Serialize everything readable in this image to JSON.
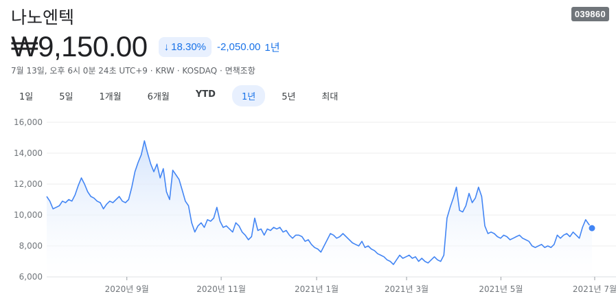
{
  "stock": {
    "name": "나노엔텍",
    "ticker": "039860",
    "price": "₩9,150.00",
    "change_percent": "18.30%",
    "change_arrow": "down-arrow-icon",
    "change_abs": "-2,050.00",
    "change_period": "1년",
    "meta": "7월 13일, 오후 6시 0분 24초 UTC+9 · KRW · KOSDAQ · 면책조항"
  },
  "tabs": [
    {
      "label": "1일",
      "active": false
    },
    {
      "label": "5일",
      "active": false
    },
    {
      "label": "1개월",
      "active": false
    },
    {
      "label": "6개월",
      "active": false
    },
    {
      "label": "YTD",
      "active": false
    },
    {
      "label": "1년",
      "active": true
    },
    {
      "label": "5년",
      "active": false
    },
    {
      "label": "최대",
      "active": false
    }
  ],
  "colors": {
    "line": "#4285f4",
    "fill_top": "#d2e3fc",
    "accent": "#1a73e8"
  },
  "chart_data": {
    "type": "area",
    "ylim": [
      6000,
      16000
    ],
    "yticks": [
      "16,000",
      "14,000",
      "12,000",
      "10,000",
      "8,000",
      "6,000"
    ],
    "ytick_values": [
      16000,
      14000,
      12000,
      10000,
      8000,
      6000
    ],
    "xticks": [
      {
        "label": "2020년 9월",
        "x": 0.147
      },
      {
        "label": "2020년 11월",
        "x": 0.32
      },
      {
        "label": "2021년 1월",
        "x": 0.495
      },
      {
        "label": "2021년 3월",
        "x": 0.66
      },
      {
        "label": "2021년 5월",
        "x": 0.833
      },
      {
        "label": "2021년 7월",
        "x": 1.005
      }
    ],
    "series": [
      {
        "values": [
          11200,
          10900,
          10400,
          10500,
          10600,
          10900,
          10800,
          11000,
          10900,
          11300,
          11900,
          12400,
          12000,
          11500,
          11200,
          11100,
          10900,
          10800,
          10400,
          10700,
          10900,
          10800,
          11000,
          11200,
          10900,
          10800,
          11000,
          11800,
          12800,
          13400,
          13900,
          14800,
          14000,
          13300,
          12800,
          13300,
          12400,
          13000,
          11500,
          11000,
          12900,
          12600,
          12300,
          11600,
          10900,
          10600,
          9500,
          8900,
          9300,
          9500,
          9200,
          9700,
          9600,
          9800,
          10500,
          9600,
          9200,
          9300,
          9100,
          8900,
          9500,
          9300,
          8900,
          8700,
          8400,
          8600,
          9800,
          9000,
          9100,
          8700,
          9100,
          9000,
          9200,
          9100,
          9200,
          8900,
          9000,
          8700,
          8500,
          8700,
          8700,
          8600,
          8300,
          8400,
          8100,
          7900,
          7800,
          7600,
          8000,
          8400,
          8800,
          8700,
          8500,
          8600,
          8800,
          8600,
          8400,
          8200,
          8100,
          8000,
          8300,
          7900,
          8000,
          7800,
          7700,
          7500,
          7400,
          7300,
          7100,
          7000,
          6800,
          7100,
          7400,
          7200,
          7300,
          7400,
          7200,
          7300,
          7000,
          7200,
          7000,
          6900,
          7100,
          7300,
          7100,
          7000,
          7400,
          9800,
          10500,
          11100,
          11800,
          10300,
          10200,
          10600,
          11400,
          10800,
          11100,
          11800,
          11200,
          9300,
          8800,
          8900,
          8800,
          8600,
          8500,
          8700,
          8600,
          8400,
          8500,
          8600,
          8700,
          8500,
          8400,
          8300,
          8000,
          7900,
          8000,
          8100,
          7900,
          8000,
          7900,
          8100,
          8700,
          8500,
          8700,
          8800,
          8600,
          8900,
          8700,
          8500,
          9200,
          9700,
          9400,
          9150
        ]
      }
    ]
  }
}
